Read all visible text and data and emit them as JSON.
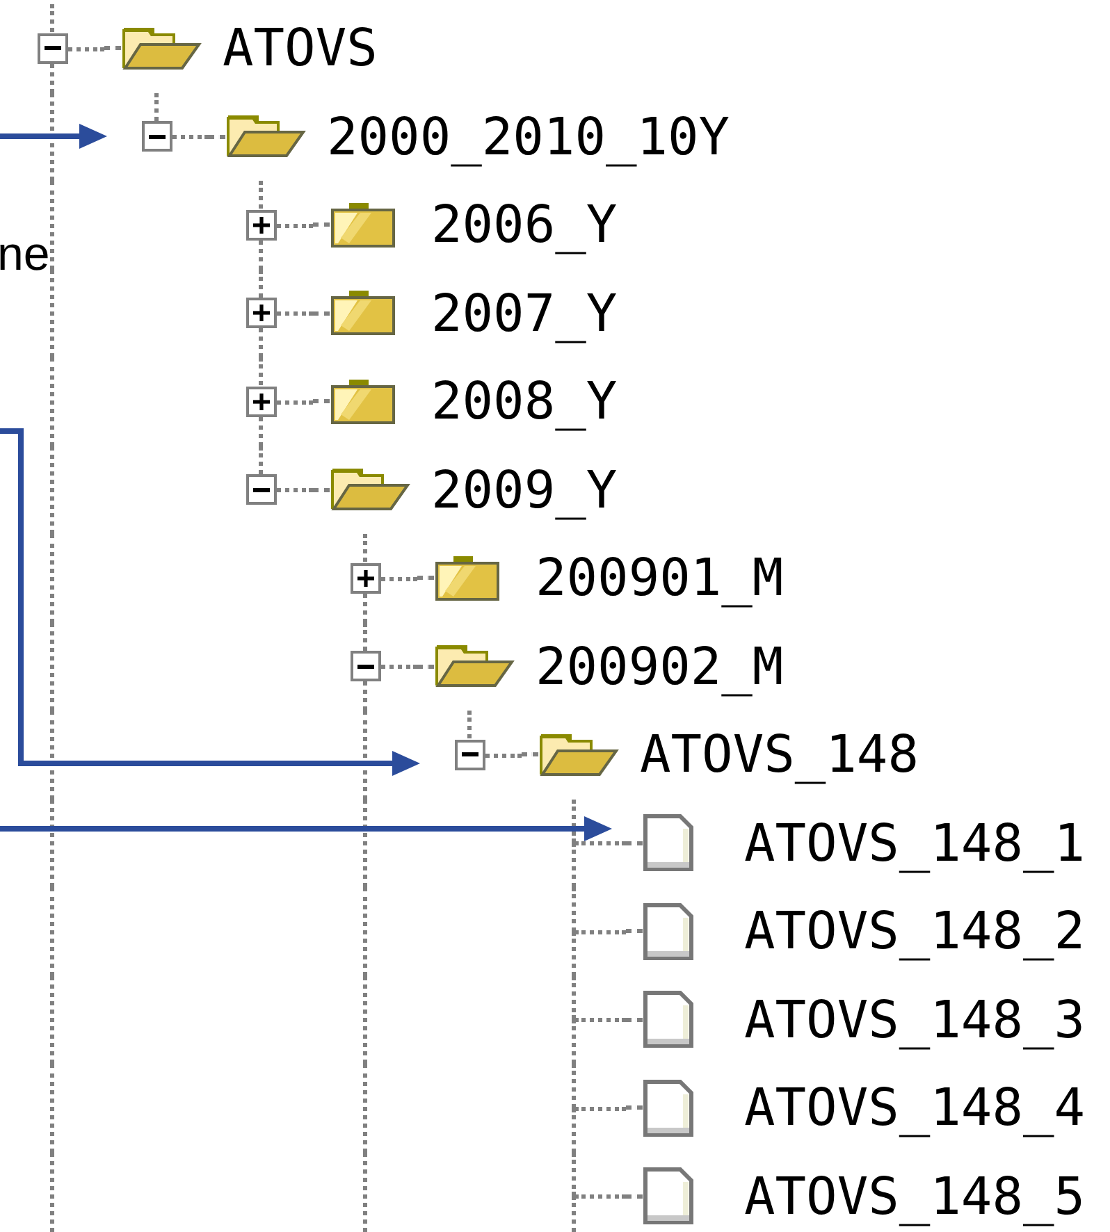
{
  "side_note": "ne",
  "tree": [
    {
      "label": "ATOVS",
      "kind": "folder",
      "expanded": true,
      "continues_below": true,
      "children": [
        {
          "label": "2000_2010_10Y",
          "kind": "folder",
          "expanded": true,
          "continues_below": false,
          "children": [
            {
              "label": "2006_Y",
              "kind": "folder",
              "expanded": false
            },
            {
              "label": "2007_Y",
              "kind": "folder",
              "expanded": false
            },
            {
              "label": "2008_Y",
              "kind": "folder",
              "expanded": false
            },
            {
              "label": "2009_Y",
              "kind": "folder",
              "expanded": true,
              "continues_below": false,
              "children": [
                {
                  "label": "200901_M",
                  "kind": "folder",
                  "expanded": false
                },
                {
                  "label": "200902_M",
                  "kind": "folder",
                  "expanded": true,
                  "continues_below": true,
                  "children": [
                    {
                      "label": "ATOVS_148",
                      "kind": "folder",
                      "expanded": true,
                      "continues_below": false,
                      "children": [
                        {
                          "label": "ATOVS_148_1",
                          "kind": "file"
                        },
                        {
                          "label": "ATOVS_148_2",
                          "kind": "file"
                        },
                        {
                          "label": "ATOVS_148_3",
                          "kind": "file"
                        },
                        {
                          "label": "ATOVS_148_4",
                          "kind": "file"
                        },
                        {
                          "label": "ATOVS_148_5",
                          "kind": "file",
                          "continues_below": true
                        }
                      ]
                    }
                  ]
                }
              ]
            }
          ]
        }
      ]
    }
  ]
}
